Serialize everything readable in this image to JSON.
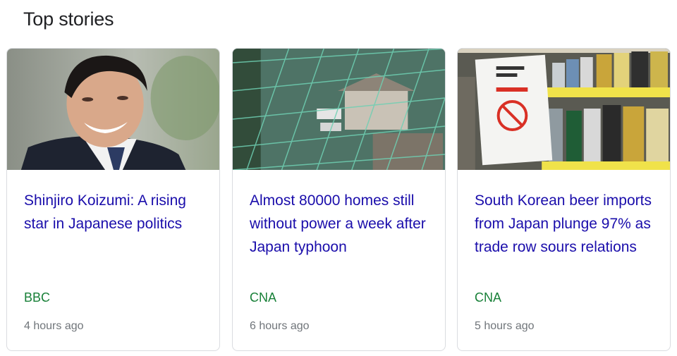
{
  "section": {
    "title": "Top stories"
  },
  "stories": [
    {
      "headline": "Shinjiro Koizumi: A rising star in Japanese politics",
      "source": "BBC",
      "time": "4 hours ago"
    },
    {
      "headline": "Almost 80000 homes still without power a week after Japan typhoon",
      "source": "CNA",
      "time": "6 hours ago"
    },
    {
      "headline": "South Korean beer imports from Japan plunge 97% as trade row sours relations",
      "source": "CNA",
      "time": "5 hours ago"
    }
  ],
  "colors": {
    "headline": "#1a0dab",
    "source": "#188038",
    "time": "#70757a",
    "title": "#202124",
    "border": "#dadce0"
  }
}
